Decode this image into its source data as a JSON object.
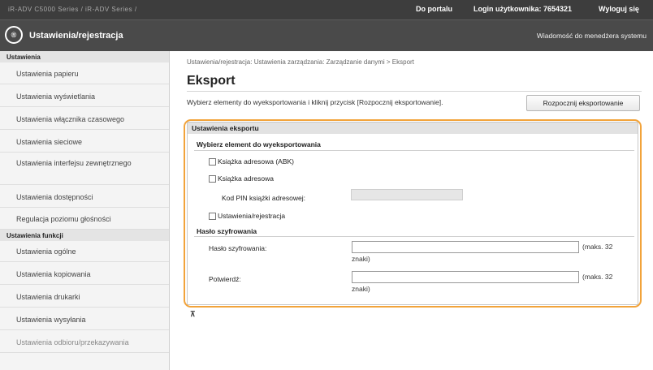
{
  "topbar": {
    "model_text": "iR-ADV C5000 Series / iR-ADV Series /",
    "portal_link": "Do portalu",
    "login_text": "Login użytkownika:  7654321",
    "logout_link": "Wyloguj się"
  },
  "header": {
    "logo_text": "®",
    "title": "Ustawienia/rejestracja",
    "message_link": "Wiadomość do menedżera systemu"
  },
  "sidebar": {
    "section1": "Ustawienia",
    "items1": [
      "Ustawienia papieru",
      "Ustawienia wyświetlania",
      "Ustawienia włącznika czasowego",
      "Ustawienia sieciowe",
      "Ustawienia interfejsu zewnętrznego",
      "Ustawienia dostępności",
      "Regulacja poziomu głośności"
    ],
    "section2": "Ustawienia funkcji",
    "items2": [
      "Ustawienia ogólne",
      "Ustawienia kopiowania",
      "Ustawienia drukarki",
      "Ustawienia wysyłania",
      "Ustawienia odbioru/przekazywania"
    ]
  },
  "main": {
    "breadcrumb": "Ustawienia/rejestracja: Ustawienia zarządzania: Zarządzanie danymi > Eksport",
    "title": "Eksport",
    "description": "Wybierz elementy do wyeksportowania i kliknij przycisk [Rozpocznij eksportowanie].",
    "start_button": "Rozpocznij eksportowanie",
    "settings_title": "Ustawienia eksportu",
    "select_title": "Wybierz element do wyeksportowania",
    "items": [
      {
        "label": "Książka adresowa (ABK)",
        "checked": false
      },
      {
        "label": "Książka adresowa",
        "checked": false
      },
      {
        "label": "Ustawienia/rejestracja",
        "checked": false
      }
    ],
    "pin_label": "Kod PIN książki adresowej:",
    "pin_value": "",
    "encryption_title": "Hasło szyfrowania",
    "password_label": "Hasło szyfrowania:",
    "password_value": "",
    "password_hint": "(maks. 32",
    "password_hint_tail": "znaki)",
    "confirm_label": "Potwierdź:",
    "confirm_value": "",
    "confirm_hint": "(maks. 32",
    "confirm_hint_tail": "znaki)",
    "back_to_top": "⊼"
  },
  "colors": {
    "highlight": "#f2a33a",
    "topbar_bg": "#3d3d3d",
    "header_bg": "#4a4a4a"
  }
}
